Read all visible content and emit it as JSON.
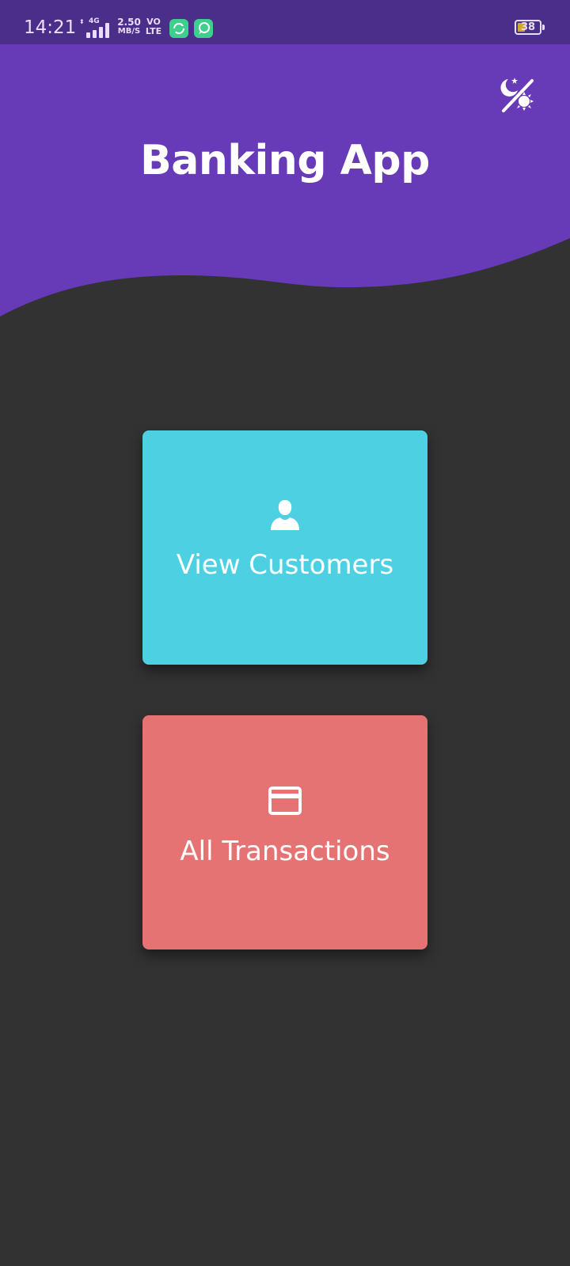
{
  "status_bar": {
    "time": "14:21",
    "network_type": "4G",
    "net_speed_value": "2.50",
    "net_speed_unit": "MB/S",
    "volte_top": "VO",
    "volte_bottom": "LTE",
    "battery_level": "38",
    "icons": [
      "signal-icon",
      "sync-app-icon",
      "chat-app-icon",
      "battery-icon"
    ]
  },
  "header": {
    "title": "Banking App",
    "theme_toggle_icon": "day-night-toggle-icon",
    "color": "#673ab7"
  },
  "tiles": [
    {
      "label": "View Customers",
      "icon": "person-icon",
      "color": "#4dd0e1"
    },
    {
      "label": "All Transactions",
      "icon": "credit-card-icon",
      "color": "#e57373"
    }
  ],
  "colors": {
    "background": "#323232",
    "status_bar": "#4b2d8a",
    "header": "#673ab7"
  }
}
